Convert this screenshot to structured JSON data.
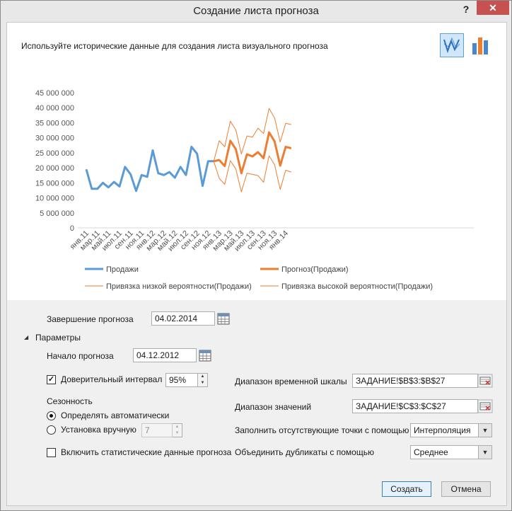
{
  "dialog": {
    "title": "Создание листа прогноза",
    "help_label": "?",
    "close_label": "✕",
    "subtitle": "Используйте исторические данные для создания листа визуального прогноза"
  },
  "chart_data": {
    "type": "line",
    "ylim": [
      0,
      45000000
    ],
    "y_ticks": [
      "0",
      "5 000 000",
      "10 000 000",
      "15 000 000",
      "20 000 000",
      "25 000 000",
      "30 000 000",
      "35 000 000",
      "40 000 000",
      "45 000 000"
    ],
    "x_tick_labels": [
      "янв.11",
      "мар.11",
      "май.11",
      "июл.11",
      "сен.11",
      "ноя.11",
      "янв.12",
      "мар.12",
      "май.12",
      "июл.12",
      "сен.12",
      "ноя.12",
      "янв.13",
      "мар.13",
      "май.13",
      "июл.13",
      "сен.13",
      "ноя.13",
      "янв.14"
    ],
    "series": [
      {
        "name": "Продажи",
        "color": "#5b9bd5",
        "start_index": 0,
        "values": [
          19500000,
          13000000,
          13000000,
          15000000,
          13500000,
          15300000,
          13800000,
          20300000,
          17800000,
          12300000,
          17600000,
          17000000,
          25800000,
          18200000,
          17600000,
          18600000,
          16700000,
          20300000,
          17600000,
          27000000,
          24700000,
          14000000,
          22200000,
          22200000
        ]
      },
      {
        "name": "Прогноз(Продажи)",
        "color": "#ed7d31",
        "start_index": 23,
        "values": [
          22200000,
          22600000,
          20600000,
          29000000,
          26200000,
          18200000,
          24500000,
          23800000,
          25200000,
          23200000,
          31800000,
          28800000,
          20700000,
          27000000,
          26500000
        ]
      },
      {
        "name": "Привязка низкой вероятности(Продажи)",
        "color": "#ed7d31",
        "start_index": 23,
        "values": [
          22200000,
          16500000,
          14500000,
          22400000,
          19600000,
          12000000,
          18200000,
          17800000,
          17400000,
          15200000,
          24000000,
          21000000,
          12800000,
          19200000,
          18600000
        ]
      },
      {
        "name": "Привязка высокой вероятности(Продажи)",
        "color": "#ed7d31",
        "start_index": 23,
        "values": [
          22200000,
          29000000,
          27000000,
          35500000,
          32600000,
          24600000,
          30600000,
          30200000,
          33200000,
          31400000,
          39800000,
          36600000,
          28600000,
          34800000,
          34400000
        ]
      }
    ]
  },
  "form": {
    "forecast_end_label": "Завершение прогноза",
    "forecast_end_value": "04.02.2014",
    "options_label": "Параметры",
    "forecast_start_label": "Начало прогноза",
    "forecast_start_value": "04.12.2012",
    "confidence_label": "Доверительный интервал",
    "confidence_checked": true,
    "confidence_value": "95%",
    "seasonality_label": "Сезонность",
    "season_auto_label": "Определять автоматически",
    "season_manual_label": "Установка вручную",
    "season_manual_value": "7",
    "include_stats_label": "Включить статистические данные прогноза",
    "timeline_range_label": "Диапазон временной шкалы",
    "timeline_range_value": "ЗАДАНИЕ!$B$3:$B$27",
    "values_range_label": "Диапазон значений",
    "values_range_value": "ЗАДАНИЕ!$C$3:$C$27",
    "fill_missing_label": "Заполнить отсутствующие точки с помощью",
    "fill_missing_value": "Интерполяция",
    "aggregate_label": "Объединить дубликаты с помощью",
    "aggregate_value": "Среднее"
  },
  "buttons": {
    "create_label": "Создать",
    "cancel_label": "Отмена"
  }
}
